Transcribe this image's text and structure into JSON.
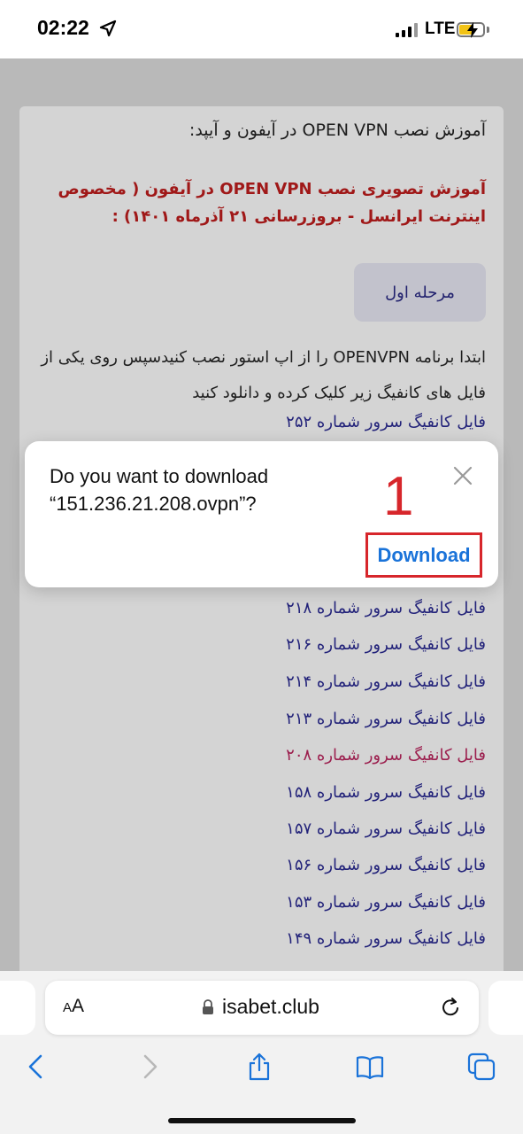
{
  "status": {
    "time": "02:22",
    "network": "LTE"
  },
  "page": {
    "intro": "آموزش نصب OPEN VPN در آیفون و آیپد:",
    "red_heading": "آموزش تصویری نصب OPEN VPN در آیفون ( مخصوص اینترنت ایرانسل - بروزرسانی ۲۱ آذرماه ۱۴۰۱) :",
    "stage_button": "مرحله اول",
    "paragraph": "ابتدا برنامه OPENVPN را از اپ استور نصب کنیدسپس روی یکی از فایل های کانفیگ زیر کلیک کرده و دانلود کنید",
    "links": [
      {
        "label": "فایل کانفیگ سرور شماره ۲۵۲",
        "visited": false
      },
      {
        "label": "فایل کانفیگ سرور شماره ۲۱۸",
        "visited": false
      },
      {
        "label": "فایل کانفیگ سرور شماره ۲۱۶",
        "visited": false
      },
      {
        "label": "فایل کانفیگ سرور شماره ۲۱۴",
        "visited": false
      },
      {
        "label": "فایل کانفیگ سرور شماره ۲۱۳",
        "visited": false
      },
      {
        "label": "فایل کانفیگ سرور شماره ۲۰۸",
        "visited": true
      },
      {
        "label": "فایل کانفیگ سرور شماره ۱۵۸",
        "visited": false
      },
      {
        "label": "فایل کانفیگ سرور شماره ۱۵۷",
        "visited": false
      },
      {
        "label": "فایل کانفیگ سرور شماره ۱۵۶",
        "visited": false
      },
      {
        "label": "فایل کانفیگ سرور شماره ۱۵۳",
        "visited": false
      },
      {
        "label": "فایل کانفیگ سرور شماره ۱۴۹",
        "visited": false
      }
    ]
  },
  "dialog": {
    "message_line1": "Do you want to download",
    "message_line2": "“151.236.21.208.ovpn”?",
    "download_label": "Download",
    "annotation_number": "1"
  },
  "browser": {
    "aa_small": "A",
    "aa_big": "A",
    "url": "isabet.club"
  },
  "colors": {
    "accent_blue": "#1a73d9",
    "annotation_red": "#d7262b",
    "visited_link": "#9c1f4e",
    "link": "#23237a"
  },
  "icons": [
    "location-arrow-icon",
    "signal-icon",
    "battery-charging-icon",
    "close-icon",
    "lock-icon",
    "reload-icon",
    "back-icon",
    "forward-icon",
    "share-icon",
    "bookmarks-icon",
    "tabs-icon"
  ]
}
